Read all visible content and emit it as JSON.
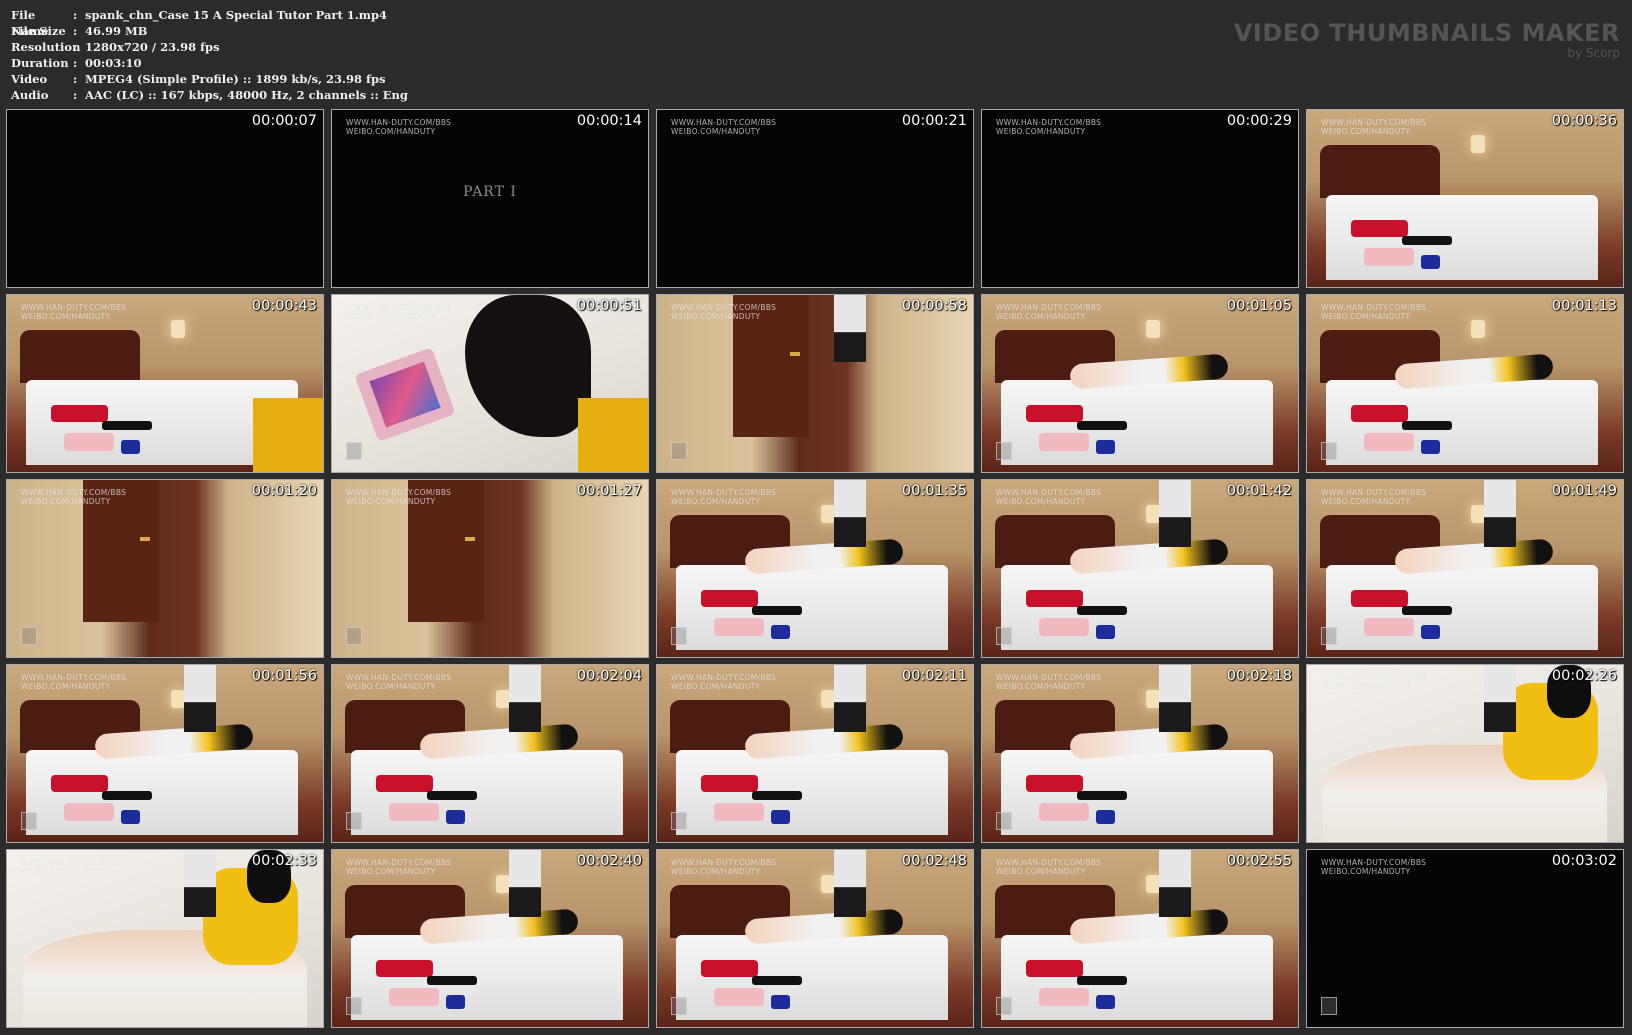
{
  "file_info": {
    "rows": [
      {
        "key": "File Name",
        "value": "spank_chn_Case 15 A Special Tutor Part 1.mp4"
      },
      {
        "key": "File Size",
        "value": "46.99 MB"
      },
      {
        "key": "Resolution",
        "value": "1280x720 / 23.98 fps"
      },
      {
        "key": "Duration",
        "value": "00:03:10"
      },
      {
        "key": "Video",
        "value": "MPEG4 (Simple Profile) :: 1899 kb/s, 23.98 fps"
      },
      {
        "key": "Audio",
        "value": "AAC (LC) :: 167 kbps, 48000 Hz, 2 channels :: Eng"
      }
    ],
    "separator": ":"
  },
  "brand": {
    "title": "VIDEO THUMBNAILS MAKER",
    "subtitle": "by Scorp"
  },
  "watermark": {
    "line1": "WWW.HAN-DUTY.COM/BBS",
    "line2": "WEIBO.COM/HANDUTY"
  },
  "part_label": "PART I",
  "thumbnails": [
    {
      "time": "00:00:07",
      "scene": "dark"
    },
    {
      "time": "00:00:14",
      "scene": "title"
    },
    {
      "time": "00:00:21",
      "scene": "dark-wm"
    },
    {
      "time": "00:00:29",
      "scene": "dark-wm"
    },
    {
      "time": "00:00:36",
      "scene": "bed-empty"
    },
    {
      "time": "00:00:43",
      "scene": "bed-empty"
    },
    {
      "time": "00:00:51",
      "scene": "tablet"
    },
    {
      "time": "00:00:58",
      "scene": "door-standing"
    },
    {
      "time": "00:01:05",
      "scene": "bed-person"
    },
    {
      "time": "00:01:13",
      "scene": "bed-person"
    },
    {
      "time": "00:01:20",
      "scene": "door"
    },
    {
      "time": "00:01:27",
      "scene": "door"
    },
    {
      "time": "00:01:35",
      "scene": "bed-person-standing"
    },
    {
      "time": "00:01:42",
      "scene": "bed-person-standing"
    },
    {
      "time": "00:01:49",
      "scene": "bed-person-standing"
    },
    {
      "time": "00:01:56",
      "scene": "bed-person-standing"
    },
    {
      "time": "00:02:04",
      "scene": "bed-person-standing"
    },
    {
      "time": "00:02:11",
      "scene": "bed-person-standing"
    },
    {
      "time": "00:02:18",
      "scene": "bed-person-standing"
    },
    {
      "time": "00:02:26",
      "scene": "closeup"
    },
    {
      "time": "00:02:33",
      "scene": "closeup"
    },
    {
      "time": "00:02:40",
      "scene": "bed-person-standing"
    },
    {
      "time": "00:02:48",
      "scene": "bed-person-standing"
    },
    {
      "time": "00:02:55",
      "scene": "bed-person-standing"
    },
    {
      "time": "00:03:02",
      "scene": "dark-end"
    }
  ]
}
